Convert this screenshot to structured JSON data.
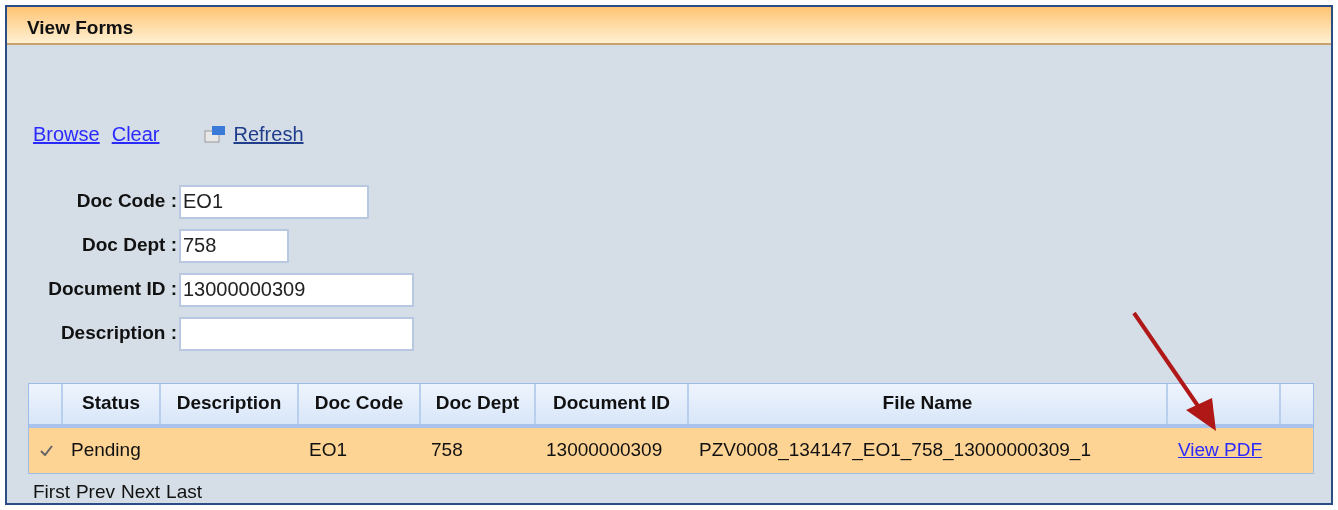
{
  "panel": {
    "title": "View Forms"
  },
  "toolbar": {
    "links": [
      {
        "label": "Browse",
        "kind": "link"
      },
      {
        "label": "Clear",
        "kind": "link"
      },
      {
        "label": "Refresh",
        "kind": "refresh"
      }
    ]
  },
  "form": {
    "fields": [
      {
        "label": "Doc Code :",
        "value": "EO1"
      },
      {
        "label": "Doc Dept :",
        "value": "758"
      },
      {
        "label": "Document ID :",
        "value": "13000000309"
      },
      {
        "label": "Description :"
      }
    ]
  },
  "table": {
    "columns": [
      "Status",
      "Description",
      "Doc Code",
      "Doc Dept",
      "Document ID",
      "File Name"
    ],
    "rows": [
      {
        "selected": true,
        "cells": [
          "Pending",
          "",
          "EO1",
          "758",
          "13000000309",
          "PZV0008_134147_EO1_758_13000000309_1"
        ],
        "action": "View PDF"
      }
    ]
  },
  "pager": [
    "First",
    "Prev",
    "Next",
    "Last"
  ]
}
